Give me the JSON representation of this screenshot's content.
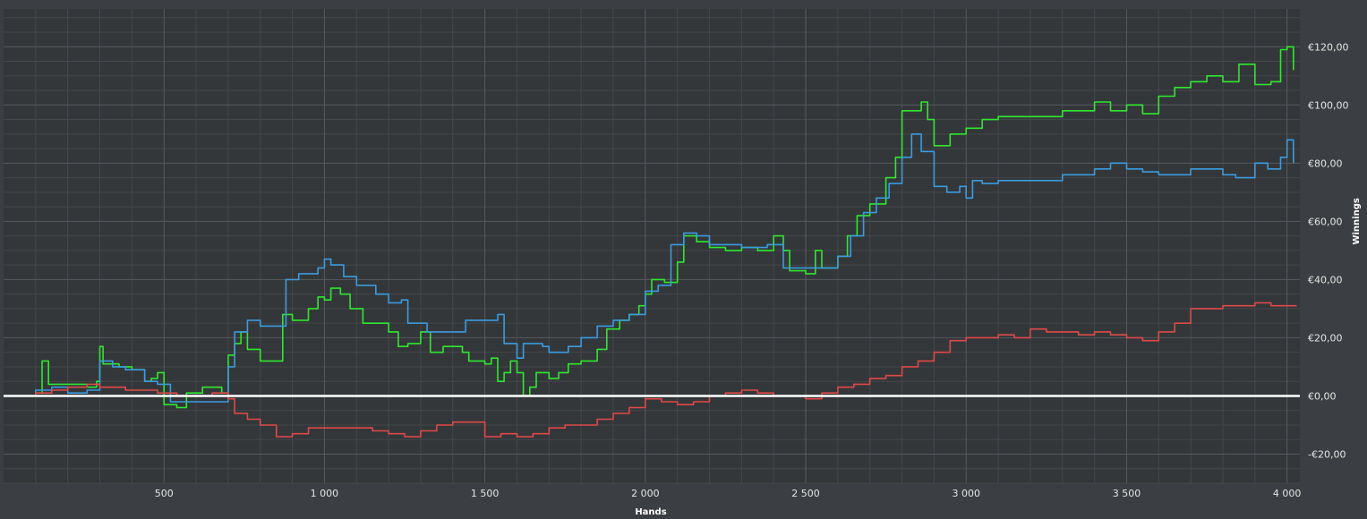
{
  "colors": {
    "background": "#3b3e42",
    "plot_background": "#34373a",
    "grid_major": "#575a5e",
    "grid_minor": "#44474b",
    "zero_line": "#ffffff",
    "green_series": "#2ee82e",
    "blue_series": "#3a9be0",
    "red_series": "#e04848"
  },
  "chart_data": {
    "type": "line",
    "title": "",
    "xlabel": "Hands",
    "ylabel": "Winnings",
    "xlim": [
      0,
      4040
    ],
    "ylim": [
      -30,
      133
    ],
    "x_tick_labels": [
      {
        "value": 500,
        "label": "500"
      },
      {
        "value": 1000,
        "label": "1 000"
      },
      {
        "value": 1500,
        "label": "1 500"
      },
      {
        "value": 2000,
        "label": "2 000"
      },
      {
        "value": 2500,
        "label": "2 500"
      },
      {
        "value": 3000,
        "label": "3 000"
      },
      {
        "value": 3500,
        "label": "3 500"
      },
      {
        "value": 4000,
        "label": "4 000"
      }
    ],
    "y_tick_labels": [
      {
        "value": -20,
        "label": "-€20,00"
      },
      {
        "value": 0,
        "label": "€0,00"
      },
      {
        "value": 20,
        "label": "€20,00"
      },
      {
        "value": 40,
        "label": "€40,00"
      },
      {
        "value": 60,
        "label": "€60,00"
      },
      {
        "value": 80,
        "label": "€80,00"
      },
      {
        "value": 100,
        "label": "€100,00"
      },
      {
        "value": 120,
        "label": "€120,00"
      }
    ],
    "grid": true,
    "legend": "none",
    "series": [
      {
        "color_key": "green_series",
        "points": [
          [
            0,
            0
          ],
          [
            100,
            1
          ],
          [
            120,
            12
          ],
          [
            140,
            4
          ],
          [
            200,
            4
          ],
          [
            260,
            3
          ],
          [
            290,
            5
          ],
          [
            300,
            17
          ],
          [
            310,
            11
          ],
          [
            360,
            10
          ],
          [
            400,
            9
          ],
          [
            440,
            5
          ],
          [
            460,
            6
          ],
          [
            480,
            8
          ],
          [
            500,
            -3
          ],
          [
            540,
            -4
          ],
          [
            570,
            1
          ],
          [
            620,
            3
          ],
          [
            680,
            1
          ],
          [
            700,
            14
          ],
          [
            720,
            18
          ],
          [
            740,
            22
          ],
          [
            760,
            16
          ],
          [
            800,
            12
          ],
          [
            850,
            12
          ],
          [
            870,
            28
          ],
          [
            900,
            26
          ],
          [
            950,
            30
          ],
          [
            980,
            34
          ],
          [
            1000,
            33
          ],
          [
            1020,
            37
          ],
          [
            1050,
            35
          ],
          [
            1080,
            30
          ],
          [
            1100,
            30
          ],
          [
            1120,
            25
          ],
          [
            1150,
            25
          ],
          [
            1200,
            22
          ],
          [
            1230,
            17
          ],
          [
            1260,
            18
          ],
          [
            1300,
            22
          ],
          [
            1330,
            15
          ],
          [
            1370,
            17
          ],
          [
            1400,
            17
          ],
          [
            1430,
            15
          ],
          [
            1450,
            12
          ],
          [
            1480,
            12
          ],
          [
            1500,
            11
          ],
          [
            1520,
            13
          ],
          [
            1540,
            5
          ],
          [
            1560,
            8
          ],
          [
            1580,
            12
          ],
          [
            1600,
            8
          ],
          [
            1620,
            0
          ],
          [
            1640,
            3
          ],
          [
            1660,
            8
          ],
          [
            1700,
            6
          ],
          [
            1730,
            8
          ],
          [
            1760,
            11
          ],
          [
            1800,
            12
          ],
          [
            1850,
            16
          ],
          [
            1880,
            23
          ],
          [
            1920,
            26
          ],
          [
            1950,
            28
          ],
          [
            1980,
            31
          ],
          [
            2000,
            35
          ],
          [
            2020,
            40
          ],
          [
            2060,
            39
          ],
          [
            2100,
            46
          ],
          [
            2120,
            55
          ],
          [
            2160,
            53
          ],
          [
            2200,
            51
          ],
          [
            2250,
            50
          ],
          [
            2300,
            51
          ],
          [
            2350,
            50
          ],
          [
            2400,
            55
          ],
          [
            2430,
            50
          ],
          [
            2450,
            43
          ],
          [
            2500,
            42
          ],
          [
            2530,
            50
          ],
          [
            2550,
            44
          ],
          [
            2600,
            48
          ],
          [
            2630,
            55
          ],
          [
            2660,
            62
          ],
          [
            2700,
            66
          ],
          [
            2750,
            75
          ],
          [
            2780,
            82
          ],
          [
            2800,
            98
          ],
          [
            2840,
            98
          ],
          [
            2860,
            101
          ],
          [
            2880,
            95
          ],
          [
            2900,
            86
          ],
          [
            2950,
            90
          ],
          [
            3000,
            92
          ],
          [
            3050,
            95
          ],
          [
            3100,
            96
          ],
          [
            3200,
            96
          ],
          [
            3300,
            98
          ],
          [
            3400,
            101
          ],
          [
            3450,
            98
          ],
          [
            3500,
            100
          ],
          [
            3550,
            97
          ],
          [
            3600,
            103
          ],
          [
            3650,
            106
          ],
          [
            3700,
            108
          ],
          [
            3750,
            110
          ],
          [
            3800,
            108
          ],
          [
            3850,
            114
          ],
          [
            3900,
            107
          ],
          [
            3950,
            108
          ],
          [
            3980,
            119
          ],
          [
            4000,
            120
          ],
          [
            4020,
            112
          ]
        ]
      },
      {
        "color_key": "blue_series",
        "points": [
          [
            0,
            0
          ],
          [
            100,
            2
          ],
          [
            150,
            3
          ],
          [
            200,
            1
          ],
          [
            260,
            2
          ],
          [
            300,
            12
          ],
          [
            340,
            10
          ],
          [
            380,
            9
          ],
          [
            440,
            5
          ],
          [
            480,
            4
          ],
          [
            520,
            -2
          ],
          [
            560,
            -2
          ],
          [
            600,
            -2
          ],
          [
            650,
            -2
          ],
          [
            700,
            10
          ],
          [
            720,
            22
          ],
          [
            760,
            26
          ],
          [
            800,
            24
          ],
          [
            850,
            24
          ],
          [
            880,
            40
          ],
          [
            920,
            42
          ],
          [
            980,
            44
          ],
          [
            1000,
            47
          ],
          [
            1020,
            45
          ],
          [
            1060,
            41
          ],
          [
            1100,
            38
          ],
          [
            1160,
            35
          ],
          [
            1200,
            32
          ],
          [
            1240,
            33
          ],
          [
            1260,
            25
          ],
          [
            1320,
            22
          ],
          [
            1400,
            22
          ],
          [
            1440,
            26
          ],
          [
            1500,
            26
          ],
          [
            1540,
            28
          ],
          [
            1560,
            18
          ],
          [
            1600,
            13
          ],
          [
            1620,
            18
          ],
          [
            1680,
            17
          ],
          [
            1700,
            15
          ],
          [
            1760,
            17
          ],
          [
            1800,
            20
          ],
          [
            1850,
            24
          ],
          [
            1900,
            26
          ],
          [
            1950,
            28
          ],
          [
            2000,
            36
          ],
          [
            2040,
            38
          ],
          [
            2080,
            52
          ],
          [
            2120,
            56
          ],
          [
            2160,
            55
          ],
          [
            2200,
            52
          ],
          [
            2300,
            51
          ],
          [
            2380,
            52
          ],
          [
            2430,
            44
          ],
          [
            2480,
            44
          ],
          [
            2550,
            44
          ],
          [
            2600,
            48
          ],
          [
            2640,
            55
          ],
          [
            2680,
            63
          ],
          [
            2720,
            68
          ],
          [
            2760,
            73
          ],
          [
            2800,
            82
          ],
          [
            2830,
            90
          ],
          [
            2860,
            84
          ],
          [
            2900,
            72
          ],
          [
            2940,
            70
          ],
          [
            2980,
            72
          ],
          [
            3000,
            68
          ],
          [
            3020,
            74
          ],
          [
            3050,
            73
          ],
          [
            3100,
            74
          ],
          [
            3200,
            74
          ],
          [
            3300,
            76
          ],
          [
            3400,
            78
          ],
          [
            3450,
            80
          ],
          [
            3500,
            78
          ],
          [
            3550,
            77
          ],
          [
            3600,
            76
          ],
          [
            3650,
            76
          ],
          [
            3700,
            78
          ],
          [
            3750,
            78
          ],
          [
            3800,
            76
          ],
          [
            3840,
            75
          ],
          [
            3900,
            80
          ],
          [
            3940,
            78
          ],
          [
            3980,
            82
          ],
          [
            4000,
            88
          ],
          [
            4020,
            80
          ]
        ]
      },
      {
        "color_key": "red_series",
        "points": [
          [
            0,
            0
          ],
          [
            100,
            1
          ],
          [
            150,
            2
          ],
          [
            200,
            3
          ],
          [
            260,
            4
          ],
          [
            300,
            3
          ],
          [
            380,
            2
          ],
          [
            440,
            2
          ],
          [
            480,
            1
          ],
          [
            540,
            0
          ],
          [
            600,
            0
          ],
          [
            650,
            1
          ],
          [
            700,
            -1
          ],
          [
            720,
            -6
          ],
          [
            760,
            -8
          ],
          [
            800,
            -10
          ],
          [
            850,
            -14
          ],
          [
            900,
            -13
          ],
          [
            950,
            -11
          ],
          [
            1000,
            -11
          ],
          [
            1050,
            -11
          ],
          [
            1100,
            -11
          ],
          [
            1150,
            -12
          ],
          [
            1200,
            -13
          ],
          [
            1250,
            -14
          ],
          [
            1300,
            -12
          ],
          [
            1350,
            -10
          ],
          [
            1400,
            -9
          ],
          [
            1450,
            -9
          ],
          [
            1500,
            -14
          ],
          [
            1550,
            -13
          ],
          [
            1600,
            -14
          ],
          [
            1650,
            -13
          ],
          [
            1700,
            -11
          ],
          [
            1750,
            -10
          ],
          [
            1800,
            -10
          ],
          [
            1850,
            -8
          ],
          [
            1900,
            -6
          ],
          [
            1950,
            -4
          ],
          [
            2000,
            -1
          ],
          [
            2050,
            -2
          ],
          [
            2100,
            -3
          ],
          [
            2150,
            -2
          ],
          [
            2200,
            0
          ],
          [
            2250,
            1
          ],
          [
            2300,
            2
          ],
          [
            2350,
            1
          ],
          [
            2400,
            0
          ],
          [
            2450,
            0
          ],
          [
            2500,
            -1
          ],
          [
            2550,
            1
          ],
          [
            2600,
            3
          ],
          [
            2650,
            4
          ],
          [
            2700,
            6
          ],
          [
            2750,
            7
          ],
          [
            2800,
            10
          ],
          [
            2850,
            12
          ],
          [
            2900,
            15
          ],
          [
            2950,
            19
          ],
          [
            3000,
            20
          ],
          [
            3050,
            20
          ],
          [
            3100,
            21
          ],
          [
            3150,
            20
          ],
          [
            3200,
            23
          ],
          [
            3250,
            22
          ],
          [
            3300,
            22
          ],
          [
            3350,
            21
          ],
          [
            3400,
            22
          ],
          [
            3450,
            21
          ],
          [
            3500,
            20
          ],
          [
            3550,
            19
          ],
          [
            3600,
            22
          ],
          [
            3650,
            25
          ],
          [
            3700,
            30
          ],
          [
            3750,
            30
          ],
          [
            3800,
            31
          ],
          [
            3850,
            31
          ],
          [
            3900,
            32
          ],
          [
            3950,
            31
          ],
          [
            4000,
            31
          ],
          [
            4030,
            31
          ]
        ]
      }
    ]
  }
}
